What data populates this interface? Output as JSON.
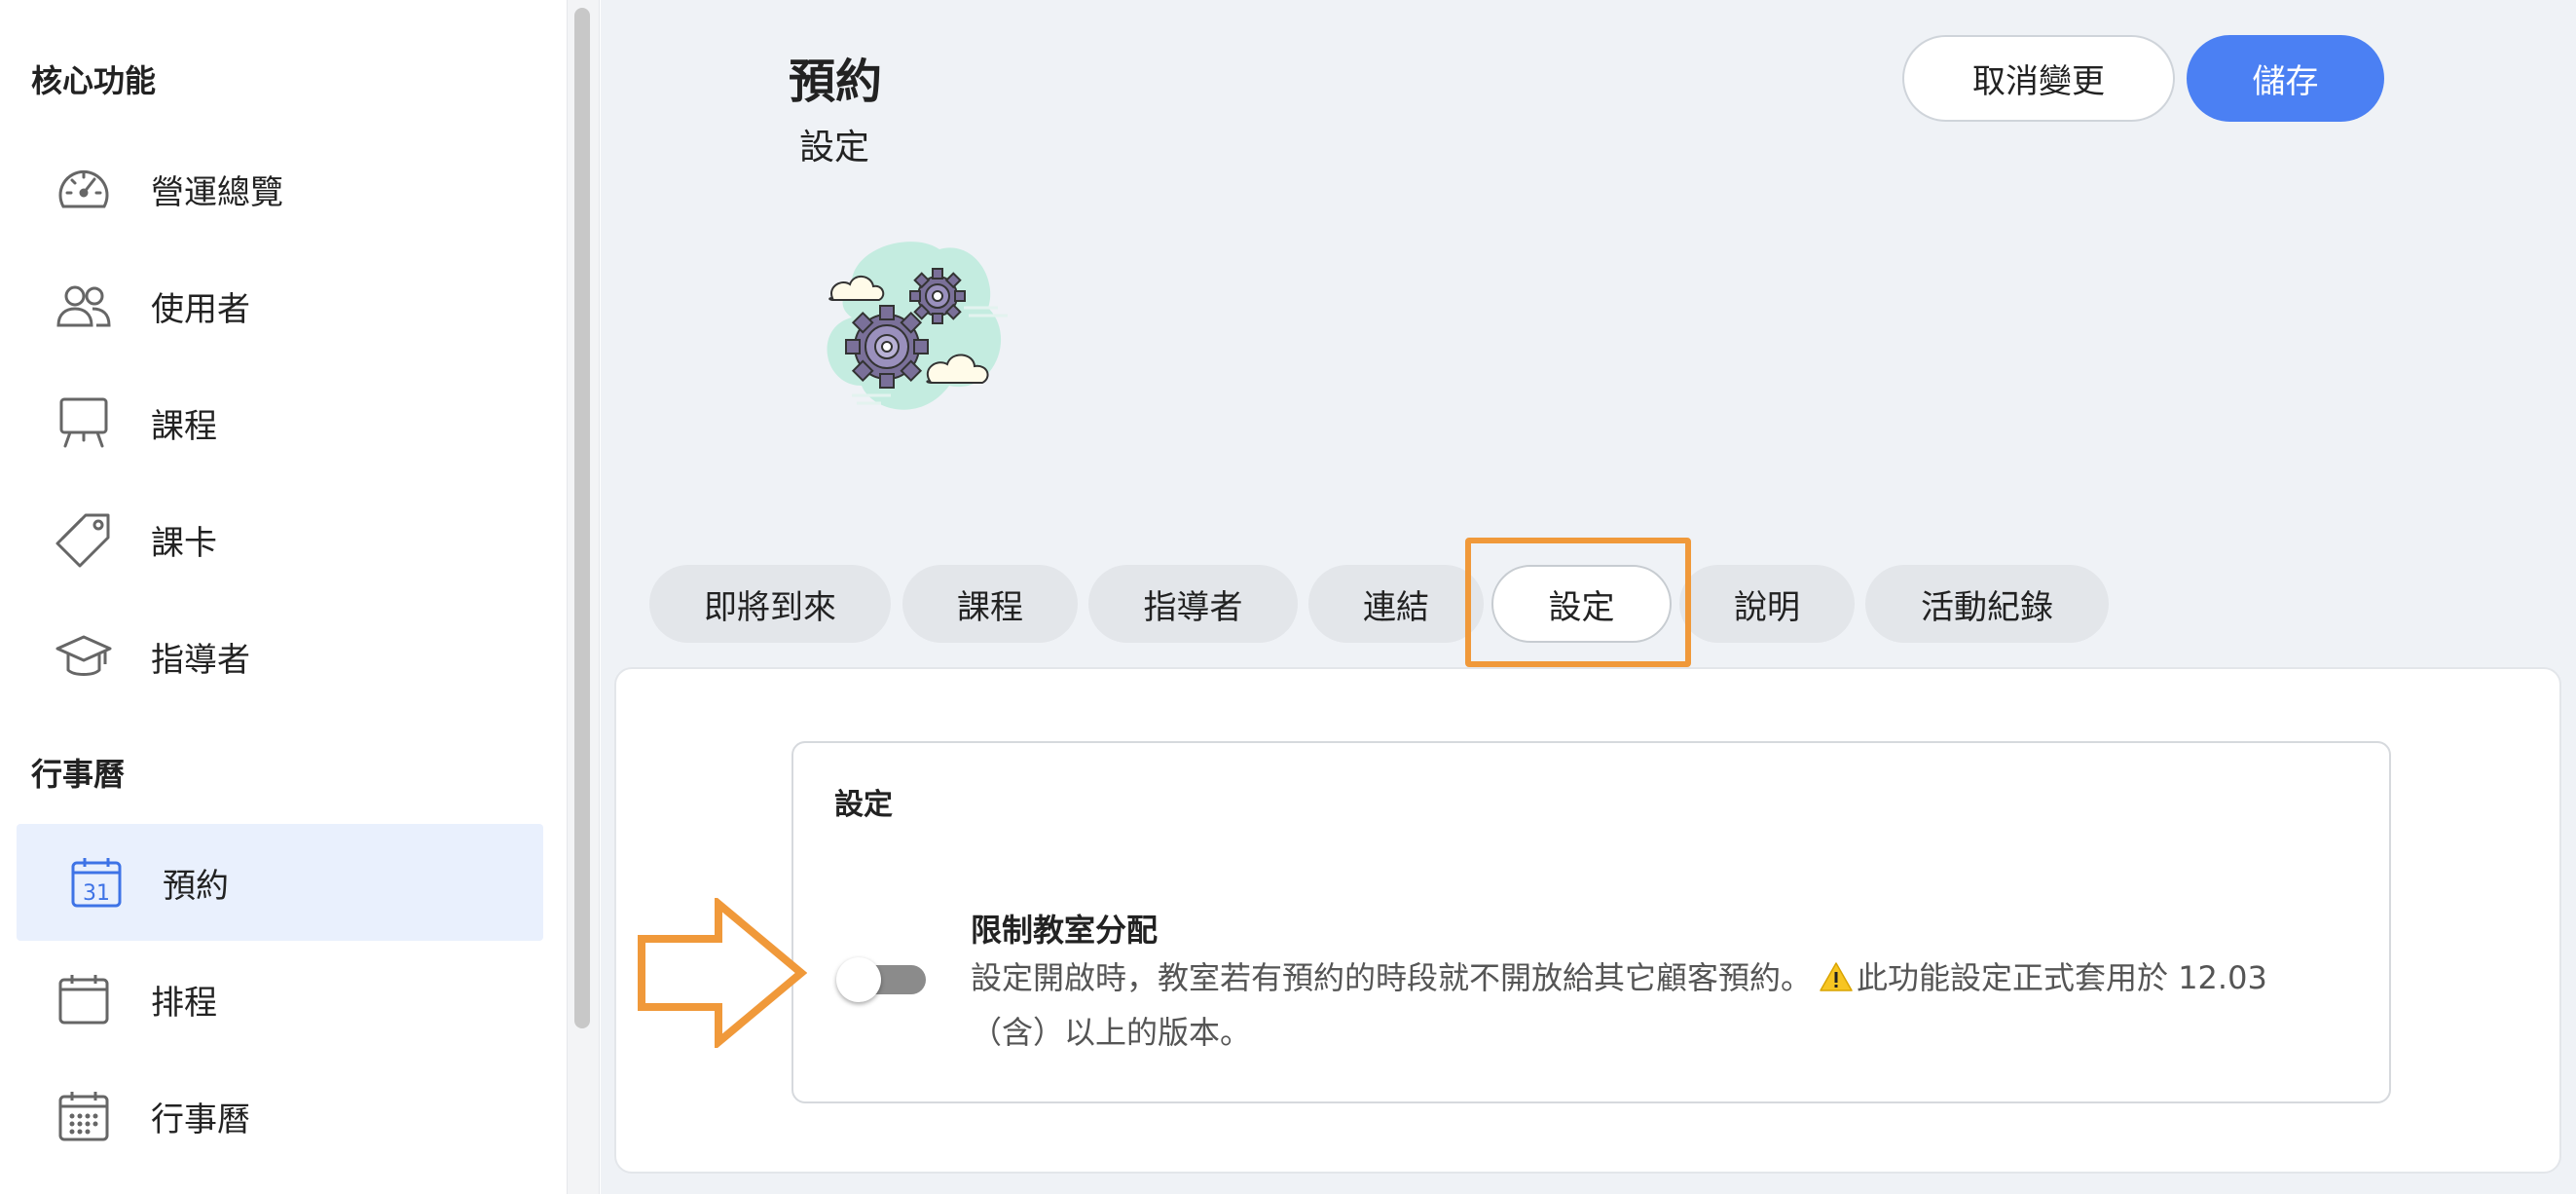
{
  "sidebar": {
    "sections": [
      {
        "title": "核心功能"
      },
      {
        "title": "行事曆"
      }
    ],
    "core_items": [
      {
        "label": "營運總覽",
        "icon": "speedometer-icon"
      },
      {
        "label": "使用者",
        "icon": "users-icon"
      },
      {
        "label": "課程",
        "icon": "easel-icon"
      },
      {
        "label": "課卡",
        "icon": "tag-icon"
      },
      {
        "label": "指導者",
        "icon": "graduation-cap-icon"
      }
    ],
    "calendar_items": [
      {
        "label": "預約",
        "icon": "calendar-31-icon",
        "active": true,
        "icon_text": "31"
      },
      {
        "label": "排程",
        "icon": "calendar-blank-icon"
      },
      {
        "label": "行事曆",
        "icon": "calendar-grid-icon"
      }
    ]
  },
  "header": {
    "title": "預約",
    "subtitle": "設定",
    "cancel_label": "取消變更",
    "save_label": "儲存"
  },
  "tabs": [
    {
      "label": "即將到來"
    },
    {
      "label": "課程"
    },
    {
      "label": "指導者"
    },
    {
      "label": "連結"
    },
    {
      "label": "設定",
      "active": true
    },
    {
      "label": "說明"
    },
    {
      "label": "活動紀錄"
    }
  ],
  "settings_card": {
    "title": "設定",
    "option": {
      "title": "限制教室分配",
      "description_part1": "設定開啟時，教室若有預約的時段就不開放給其它顧客預約。",
      "warning_icon": "warning-icon",
      "description_part2": "此功能設定正式套用於 12.03（含）以上的版本。",
      "enabled": false
    }
  },
  "colors": {
    "primary": "#4b80f3",
    "highlight": "#f0993a",
    "active_nav_bg": "#e9f0fd",
    "main_bg": "#eff2f6"
  }
}
